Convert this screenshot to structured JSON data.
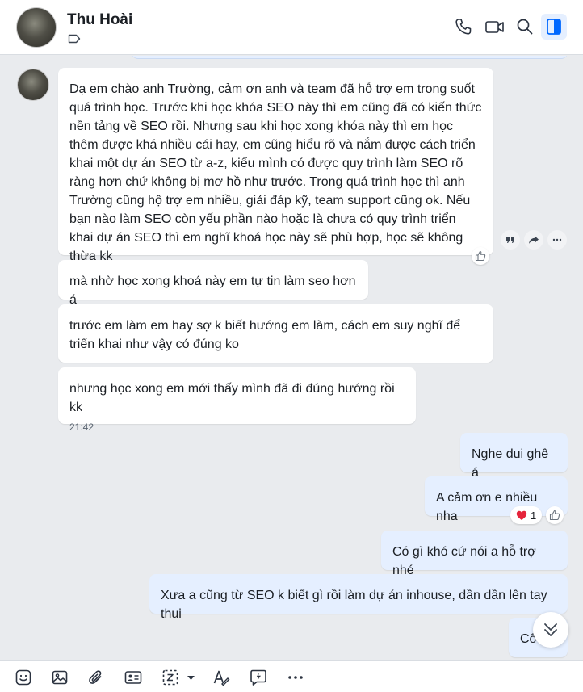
{
  "header": {
    "contact_name": "Thu Hoài",
    "icons": [
      "tag-icon",
      "phone-icon",
      "video-call-icon",
      "search-icon",
      "side-panel-icon"
    ]
  },
  "messages": [
    {
      "direction": "in",
      "text": "Dạ em chào anh Trường, cảm ơn anh và team đã hỗ trợ em trong suốt quá trình học. Trước khi học khóa SEO này thì em cũng đã có kiến thức nền tảng về SEO rồi. Nhưng sau khi học xong khóa này thì em học thêm được khá nhiều cái hay, em cũng hiểu rõ và nắm được cách triển khai một dự án SEO từ a-z, kiểu mình có được quy trình làm SEO rõ ràng hơn chứ không bị mơ hồ như trước. Trong quá trình học thì anh Trường cũng hộ trợ em nhiều, giải đáp kỹ, team support cũng ok. Nếu bạn nào làm SEO còn yếu phần nào hoặc là chưa có quy trình triển khai dự án SEO thì em nghĩ khoá học này sẽ phù hợp, học sẽ không thừa kk"
    },
    {
      "direction": "in",
      "text": "mà nhờ học xong khoá này em tự tin làm seo hơn á"
    },
    {
      "direction": "in",
      "text": "trước em làm em hay sợ k biết hướng em làm, cách em suy nghĩ để triển khai như vậy có đúng ko"
    },
    {
      "direction": "in",
      "text": "nhưng học xong em mới thấy mình đã đi đúng hướng rồi kk",
      "time": "21:42"
    },
    {
      "direction": "out",
      "text": "Nghe dui ghê á"
    },
    {
      "direction": "out",
      "text": "A cảm ơn e nhiều nha",
      "reaction_count": "1"
    },
    {
      "direction": "out",
      "text": "Có gì khó cứ nói a hỗ trợ nhé"
    },
    {
      "direction": "out",
      "text": "Xưa a cũng từ SEO k biết gì rồi làm dự án inhouse, dần dần lên tay thui"
    },
    {
      "direction": "out",
      "text": "Cô"
    }
  ],
  "message_actions": [
    "quote-icon",
    "forward-icon",
    "more-icon"
  ],
  "toolbar": [
    "sticker-icon",
    "image-icon",
    "attachment-icon",
    "contact-card-icon",
    "screenshot-icon",
    "format-text-icon",
    "quick-message-icon",
    "more-icon"
  ],
  "colors": {
    "outgoing_bubble": "#e5efff",
    "incoming_bubble": "#ffffff",
    "background": "#e9ebee",
    "accent": "#0068ff"
  }
}
